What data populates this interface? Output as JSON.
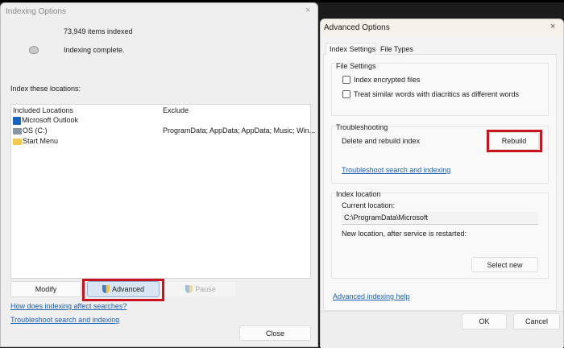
{
  "indexing_window": {
    "title": "Indexing Options",
    "items_indexed": "73,949 items indexed",
    "status": "Indexing complete.",
    "locations_label": "Index these locations:",
    "columns": [
      "Included Locations",
      "Exclude"
    ],
    "rows": [
      {
        "name": "Microsoft Outlook",
        "exclude": "",
        "icon": "outlook-icon"
      },
      {
        "name": "OS (C:)",
        "exclude": "ProgramData; AppData; AppData; Music; Win...",
        "icon": "drive-icon"
      },
      {
        "name": "Start Menu",
        "exclude": "",
        "icon": "folder-icon"
      }
    ],
    "modify_label": "Modify",
    "advanced_label": "Advanced",
    "pause_label": "Pause",
    "link_how": "How does indexing affect searches?",
    "link_troubleshoot": "Troubleshoot search and indexing",
    "close_label": "Close"
  },
  "advanced_dialog": {
    "title": "Advanced Options",
    "close_glyph": "×",
    "tabs": [
      "Index Settings",
      "File Types"
    ],
    "file_settings": {
      "label": "File Settings",
      "options": [
        {
          "label": "Index encrypted files",
          "checked": false
        },
        {
          "label": "Treat similar words with diacritics as different words",
          "checked": false
        }
      ]
    },
    "troubleshooting": {
      "label": "Troubleshooting",
      "rebuild_text": "Delete and rebuild index",
      "rebuild_label": "Rebuild",
      "link": "Troubleshoot search and indexing"
    },
    "index_location": {
      "label": "Index location",
      "current_label": "Current location:",
      "current_value": "C:\\ProgramData\\Microsoft",
      "new_label": "New location, after service is restarted:",
      "select_new_label": "Select new"
    },
    "help_link": "Advanced indexing help",
    "ok_label": "OK",
    "cancel_label": "Cancel"
  },
  "colors": {
    "highlight": "#c8141e",
    "link": "#1d5fb5"
  }
}
